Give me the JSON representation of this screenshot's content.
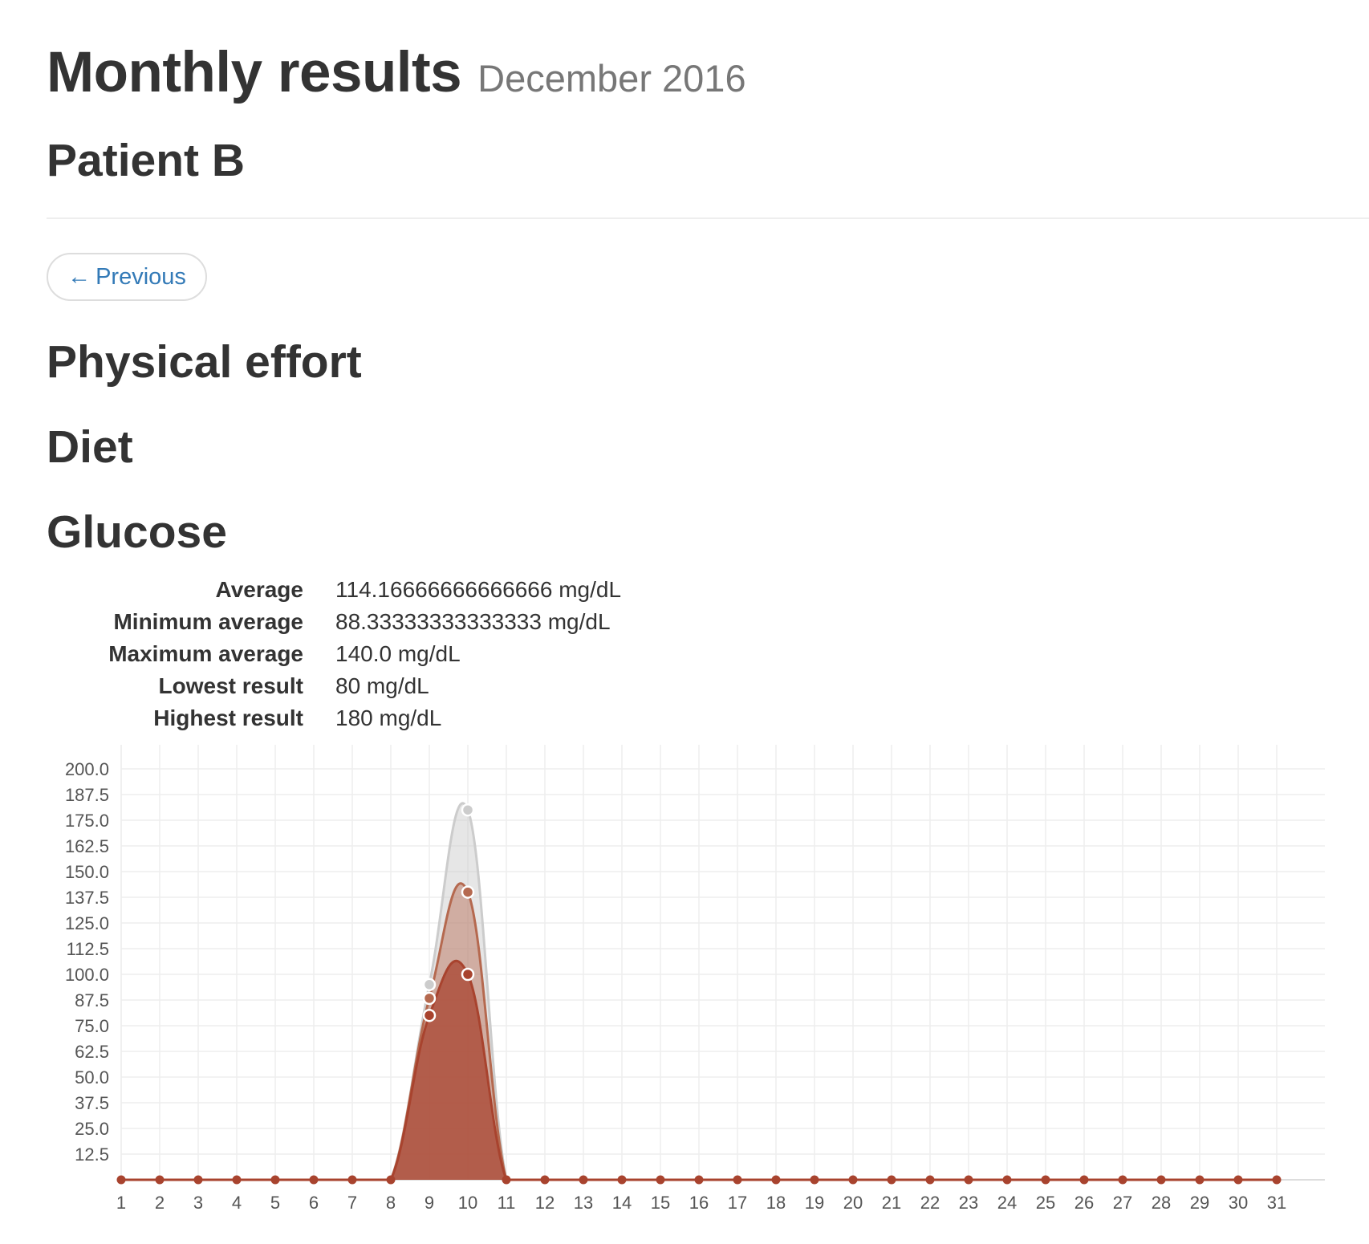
{
  "header": {
    "title": "Monthly results",
    "subtitle": "December 2016",
    "patient": "Patient B"
  },
  "nav": {
    "previous_arrow": "←",
    "previous_label": "Previous"
  },
  "sections": {
    "physical_effort": "Physical effort",
    "diet": "Diet",
    "glucose": "Glucose"
  },
  "glucose_stats": [
    {
      "label": "Average",
      "value": "114.16666666666666 mg/dL"
    },
    {
      "label": "Minimum average",
      "value": "88.33333333333333 mg/dL"
    },
    {
      "label": "Maximum average",
      "value": "140.0 mg/dL"
    },
    {
      "label": "Lowest result",
      "value": "80 mg/dL"
    },
    {
      "label": "Highest result",
      "value": "180 mg/dL"
    }
  ],
  "colors": {
    "max_series": "#cccccc",
    "avg_series": "#b5694f",
    "min_series": "#a8432e",
    "grid": "#eeeeee",
    "link": "#337ab7"
  },
  "chart_data": {
    "type": "area",
    "x": [
      1,
      2,
      3,
      4,
      5,
      6,
      7,
      8,
      9,
      10,
      11,
      12,
      13,
      14,
      15,
      16,
      17,
      18,
      19,
      20,
      21,
      22,
      23,
      24,
      25,
      26,
      27,
      28,
      29,
      30,
      31
    ],
    "ylim": [
      0,
      200
    ],
    "yticks": [
      "12.5",
      "25.0",
      "37.5",
      "50.0",
      "62.5",
      "75.0",
      "87.5",
      "100.0",
      "112.5",
      "125.0",
      "137.5",
      "150.0",
      "162.5",
      "175.0",
      "187.5",
      "200.0"
    ],
    "grid": true,
    "series": [
      {
        "values": [
          0,
          0,
          0,
          0,
          0,
          0,
          0,
          0,
          95,
          180,
          0,
          0,
          0,
          0,
          0,
          0,
          0,
          0,
          0,
          0,
          0,
          0,
          0,
          0,
          0,
          0,
          0,
          0,
          0,
          0,
          0
        ]
      },
      {
        "values": [
          0,
          0,
          0,
          0,
          0,
          0,
          0,
          0,
          88.33,
          140,
          0,
          0,
          0,
          0,
          0,
          0,
          0,
          0,
          0,
          0,
          0,
          0,
          0,
          0,
          0,
          0,
          0,
          0,
          0,
          0,
          0
        ]
      },
      {
        "values": [
          0,
          0,
          0,
          0,
          0,
          0,
          0,
          0,
          80,
          100,
          0,
          0,
          0,
          0,
          0,
          0,
          0,
          0,
          0,
          0,
          0,
          0,
          0,
          0,
          0,
          0,
          0,
          0,
          0,
          0,
          0
        ]
      }
    ]
  }
}
